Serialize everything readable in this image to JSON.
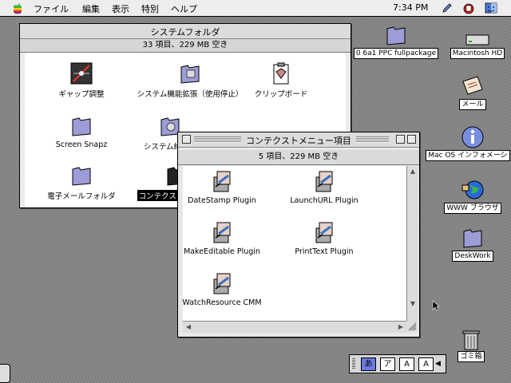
{
  "menubar": {
    "items": [
      "ファイル",
      "編集",
      "表示",
      "特別",
      "ヘルプ"
    ],
    "clock": "7:34 PM"
  },
  "system_folder": {
    "title": "システムフォルダ",
    "info": "33 項目、229 MB 空き",
    "items": [
      {
        "label": "ギャップ調整",
        "icon": "folder-icon"
      },
      {
        "label": "システム機能拡張（使用停止）",
        "icon": "folder-icon"
      },
      {
        "label": "クリップボード",
        "icon": "clipboard-icon"
      },
      {
        "label": "Screen Snapz",
        "icon": "folder-icon"
      },
      {
        "label": "システム終了項",
        "icon": "folder-icon"
      },
      {
        "label": "電子メールフォルダ",
        "icon": "folder-icon"
      },
      {
        "label": "コンテクスト",
        "icon": "folder-icon"
      }
    ]
  },
  "context_menu_window": {
    "title": "コンテクストメニュー項目",
    "info": "5 項目、229 MB 空き",
    "items": [
      {
        "label": "DateStamp Plugin"
      },
      {
        "label": "LaunchURL Plugin"
      },
      {
        "label": "MakeEditable Plugin"
      },
      {
        "label": "PrintText Plugin"
      },
      {
        "label": "WatchResource CMM"
      }
    ]
  },
  "desktop": {
    "items": [
      {
        "label": "0 6a1 PPC fullpackage"
      },
      {
        "label": "Macintosh HD"
      },
      {
        "label": "メール"
      },
      {
        "label": "Mac OS インフォメーシ"
      },
      {
        "label": "WWW ブラウザ"
      },
      {
        "label": "DeskWork"
      },
      {
        "label": "ゴミ箱"
      }
    ]
  },
  "palette": {
    "buttons": [
      "あ",
      "ア",
      "A",
      "A"
    ]
  },
  "colors": {
    "desktop": "#8c8c8c",
    "window": "#ececec",
    "selection": "#000000",
    "folder": "#9c9cd6"
  }
}
